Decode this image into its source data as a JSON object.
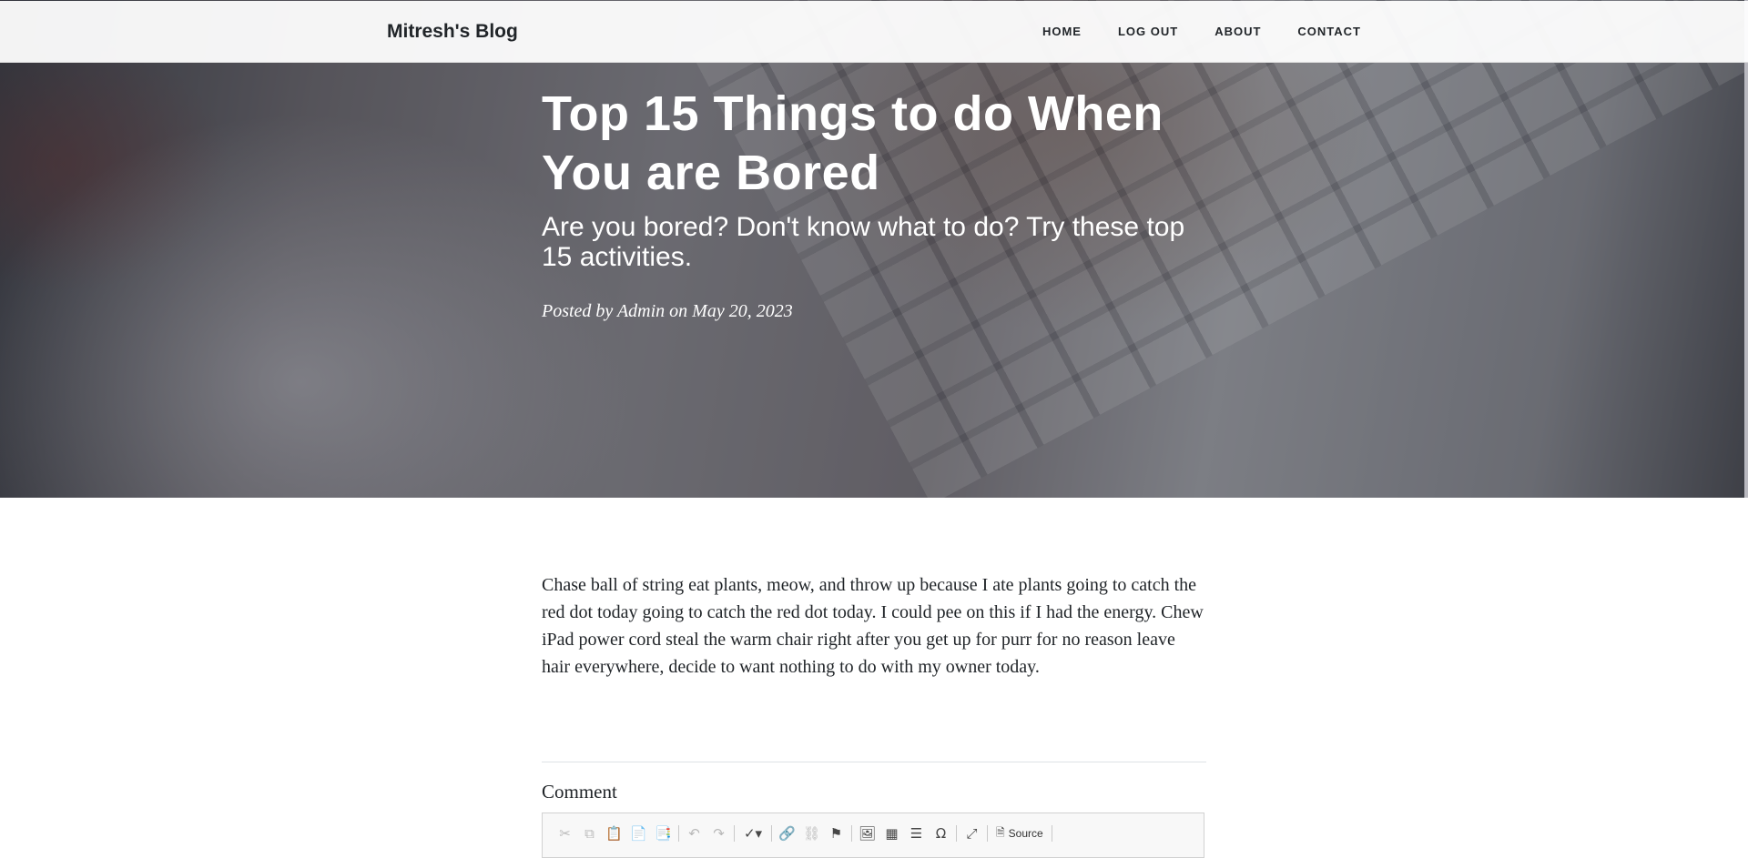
{
  "navbar": {
    "brand": "Mitresh's Blog",
    "links": [
      "HOME",
      "LOG OUT",
      "ABOUT",
      "CONTACT"
    ]
  },
  "post": {
    "title": "Top 15 Things to do When You are Bored",
    "subtitle": "Are you bored? Don't know what to do? Try these top 15 activities.",
    "meta": "Posted by Admin on May 20, 2023",
    "body": "Chase ball of string eat plants, meow, and throw up because I ate plants going to catch the red dot today going to catch the red dot today. I could pee on this if I had the energy. Chew iPad power cord steal the warm chair right after you get up for purr for no reason leave hair everywhere, decide to want nothing to do with my owner today."
  },
  "comment": {
    "label": "Comment",
    "toolbar": {
      "icons": {
        "cut": "✂",
        "copy": "⧉",
        "paste": "📋",
        "paste_text": "📄",
        "paste_word": "📑",
        "undo": "↶",
        "redo": "↷",
        "spellcheck": "✓▾",
        "link": "🔗",
        "unlink": "⛓",
        "anchor": "⚑",
        "image": "🖼",
        "table": "▦",
        "hr": "☰",
        "special_char": "Ω",
        "maximize": "⤢",
        "source": "🗎"
      },
      "source_label": "Source"
    }
  }
}
